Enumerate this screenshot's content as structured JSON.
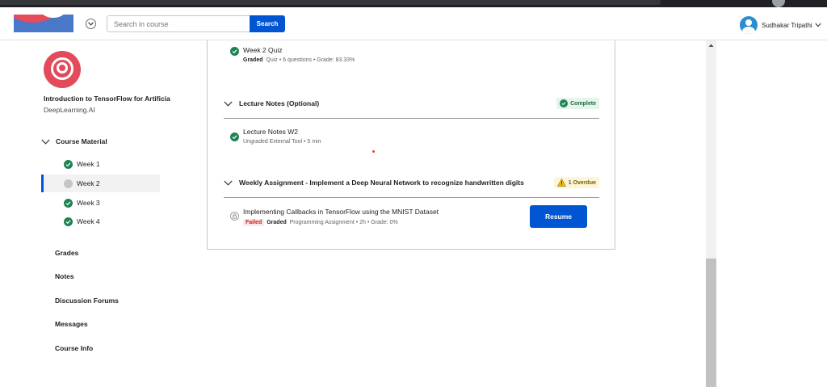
{
  "header": {
    "search_placeholder": "Search in course",
    "search_button": "Search",
    "user_name": "Sudhakar Tripathi"
  },
  "sidebar": {
    "course_title": "Introduction to TensorFlow for Artificia",
    "course_partner": "DeepLearning.AI",
    "section_label": "Course Material",
    "weeks": [
      {
        "label": "Week 1",
        "status": "complete"
      },
      {
        "label": "Week 2",
        "status": "current"
      },
      {
        "label": "Week 3",
        "status": "complete"
      },
      {
        "label": "Week 4",
        "status": "complete"
      }
    ],
    "links": [
      "Grades",
      "Notes",
      "Discussion Forums",
      "Messages",
      "Course Info"
    ]
  },
  "main": {
    "quiz": {
      "title": "Week 2 Quiz",
      "graded": "Graded",
      "meta": "Quiz • 6 questions • Grade: 83.33%"
    },
    "lecture_notes_section": {
      "title": "Lecture Notes (Optional)",
      "badge": "Complete"
    },
    "lecture_notes_item": {
      "title": "Lecture Notes W2",
      "meta": "Ungraded External Tool • 5 min"
    },
    "assignment_section": {
      "title": "Weekly Assignment - Implement a Deep Neural Network to recognize handwritten digits",
      "badge": "1 Overdue"
    },
    "assignment_item": {
      "title": "Implementing Callbacks in TensorFlow using the MNIST Dataset",
      "failed": "Failed",
      "graded": "Graded",
      "meta": "Programming Assignment • 2h • Grade: 0%",
      "button": "Resume"
    }
  },
  "colors": {
    "primary": "#0056d2",
    "success": "#1f8354",
    "brand_red": "#e34a5a",
    "overdue_bg": "#fdf5d9"
  },
  "icons": [
    "logo",
    "chevron-down-icon",
    "user-avatar-icon",
    "check-circle-icon",
    "lock-icon",
    "warning-icon"
  ]
}
